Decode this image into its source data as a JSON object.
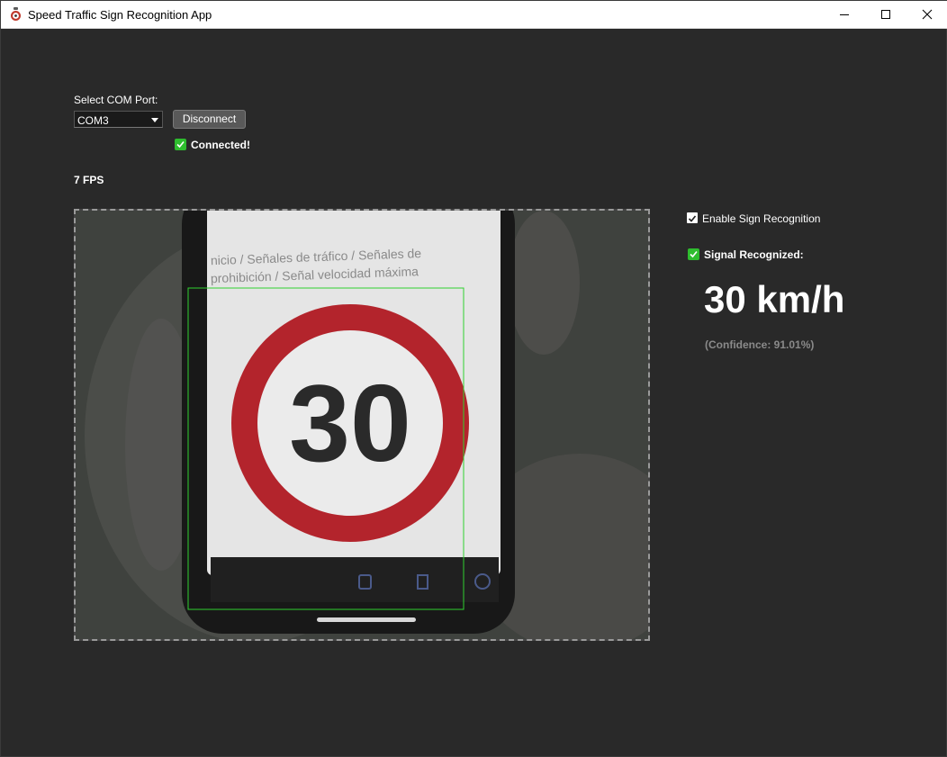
{
  "window": {
    "title": "Speed Traffic Sign Recognition App"
  },
  "controls": {
    "com_port_label": "Select COM Port:",
    "com_port_value": "COM3",
    "disconnect_label": "Disconnect",
    "connected_label": "Connected!"
  },
  "status": {
    "fps": "7 FPS"
  },
  "video": {
    "phone_text_line1": "nicio / Señales de tráfico / Señales de",
    "phone_text_line2": "prohibición / Señal velocidad máxima",
    "sign_number": "30",
    "detection_box_color": "#2fd12f"
  },
  "recognition": {
    "enable_label": "Enable Sign Recognition",
    "enable_checked": true,
    "signal_label": "Signal Recognized:",
    "signal_checked": true,
    "speed": "30 km/h",
    "confidence": "(Confidence: 91.01%)"
  },
  "colors": {
    "background": "#292929",
    "check_green": "#2ebd2e",
    "sign_red": "#b3242c"
  }
}
